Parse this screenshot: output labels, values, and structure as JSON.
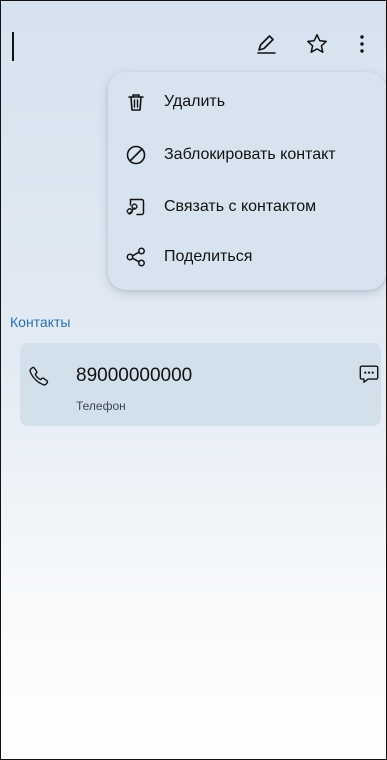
{
  "toolbar": {
    "edit_icon": "edit-icon",
    "favorite_icon": "star-icon",
    "more_icon": "more-vertical-icon"
  },
  "menu": {
    "items": [
      {
        "label": "Удалить",
        "icon": "trash-icon"
      },
      {
        "label": "Заблокировать контакт",
        "icon": "block-icon"
      },
      {
        "label": "Связать с контактом",
        "icon": "link-contact-icon"
      },
      {
        "label": "Поделиться",
        "icon": "share-icon"
      }
    ]
  },
  "contacts": {
    "section_title": "Контакты",
    "phone": {
      "number": "89000000000",
      "type": "Телефон",
      "icon": "phone-icon",
      "message_icon": "message-icon"
    }
  },
  "colors": {
    "accent": "#2b6eaf",
    "menu_background": "#d7e4ef",
    "card_background": "#d2e0ec"
  }
}
